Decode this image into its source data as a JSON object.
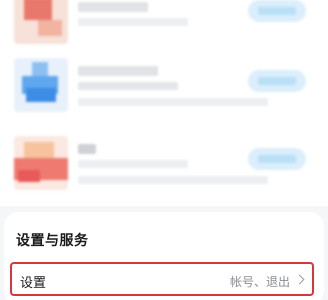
{
  "services": {
    "title": "设置与服务",
    "settings_item": {
      "label": "设置",
      "hint": "帐号、退出",
      "icon": "chevron-right-icon",
      "highlight_color": "#d8373a"
    }
  },
  "app_list": {
    "rows": [
      {
        "thumb_colors": [
          "#f2b3a0",
          "#e9786c",
          "#d9d9d9"
        ],
        "button_color": "#b9e0f7"
      },
      {
        "thumb_colors": [
          "#8cc0f0",
          "#3d8de6",
          "#5fa7ee"
        ],
        "button_color": "#b9e0f7"
      },
      {
        "thumb_colors": [
          "#f6c39e",
          "#ef7a70",
          "#e85a5a"
        ],
        "button_color": "#b9e0f7"
      }
    ]
  }
}
